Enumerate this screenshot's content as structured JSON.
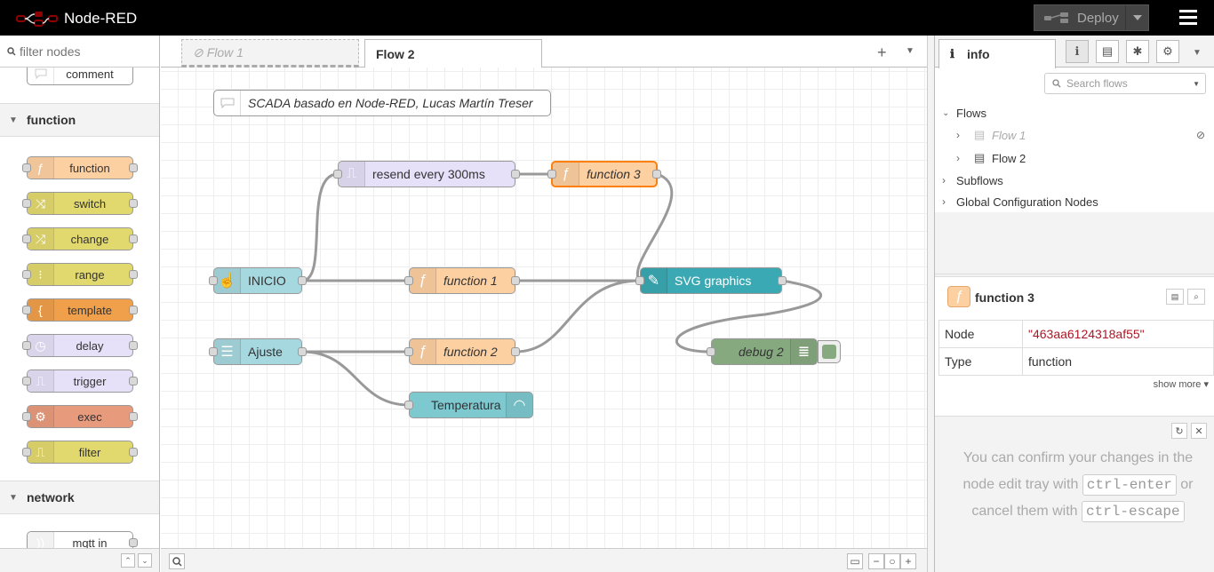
{
  "app": {
    "title": "Node-RED"
  },
  "header": {
    "deploy_label": "Deploy"
  },
  "palette": {
    "search_placeholder": "filter nodes",
    "top_node": {
      "label": "comment"
    },
    "categories": [
      {
        "label": "function"
      },
      {
        "label": "network"
      }
    ],
    "function_nodes": [
      {
        "label": "function",
        "color": "#fdd0a2",
        "icon": "function-icon"
      },
      {
        "label": "switch",
        "color": "#e2d96e",
        "icon": "switch-icon"
      },
      {
        "label": "change",
        "color": "#e2d96e",
        "icon": "change-icon"
      },
      {
        "label": "range",
        "color": "#e2d96e",
        "icon": "range-icon"
      },
      {
        "label": "template",
        "color": "#f0a04a",
        "icon": "template-icon"
      },
      {
        "label": "delay",
        "color": "#e6e0f8",
        "icon": "delay-icon"
      },
      {
        "label": "trigger",
        "color": "#e6e0f8",
        "icon": "trigger-icon"
      },
      {
        "label": "exec",
        "color": "#e89a7c",
        "icon": "gear-icon"
      },
      {
        "label": "filter",
        "color": "#e2d96e",
        "icon": "filter-icon"
      }
    ],
    "network_nodes": [
      {
        "label": "mqtt in",
        "color": "#d8bfd8",
        "icon": "mqtt-icon"
      }
    ]
  },
  "tabs": [
    {
      "label": "Flow 1",
      "disabled": true
    },
    {
      "label": "Flow 2",
      "active": true
    }
  ],
  "flow": {
    "comment": "SCADA basado en Node-RED, Lucas Martín Treser",
    "nodes": {
      "resend": {
        "label": "resend every 300ms",
        "color": "#e6e0f8"
      },
      "function3": {
        "label": "function 3",
        "color": "#fdd0a2"
      },
      "inicio": {
        "label": "INICIO",
        "color": "#a6d8e0"
      },
      "function1": {
        "label": "function 1",
        "color": "#fdd0a2"
      },
      "svg": {
        "label": "SVG graphics",
        "color": "#3aa9b3"
      },
      "ajuste": {
        "label": "Ajuste",
        "color": "#a6d8e0"
      },
      "function2": {
        "label": "function 2",
        "color": "#fdd0a2"
      },
      "debug2": {
        "label": "debug 2",
        "color": "#87a980"
      },
      "temperatura": {
        "label": "Temperatura",
        "color": "#7ec8d0"
      }
    }
  },
  "sidebar": {
    "active_tab": "info",
    "search_placeholder": "Search flows",
    "tree": {
      "flows": "Flows",
      "flow1": "Flow 1",
      "flow2": "Flow 2",
      "subflows": "Subflows",
      "global": "Global Configuration Nodes"
    },
    "selected": {
      "title": "function 3",
      "props": [
        {
          "key": "Node",
          "value": "\"463aa6124318af55\""
        },
        {
          "key": "Type",
          "value": "function"
        }
      ],
      "show_more": "show more"
    },
    "help": {
      "line1": "You can confirm your changes in the node edit tray with",
      "kbd1": "ctrl-enter",
      "line2": "or cancel them with",
      "kbd2": "ctrl-escape"
    }
  }
}
